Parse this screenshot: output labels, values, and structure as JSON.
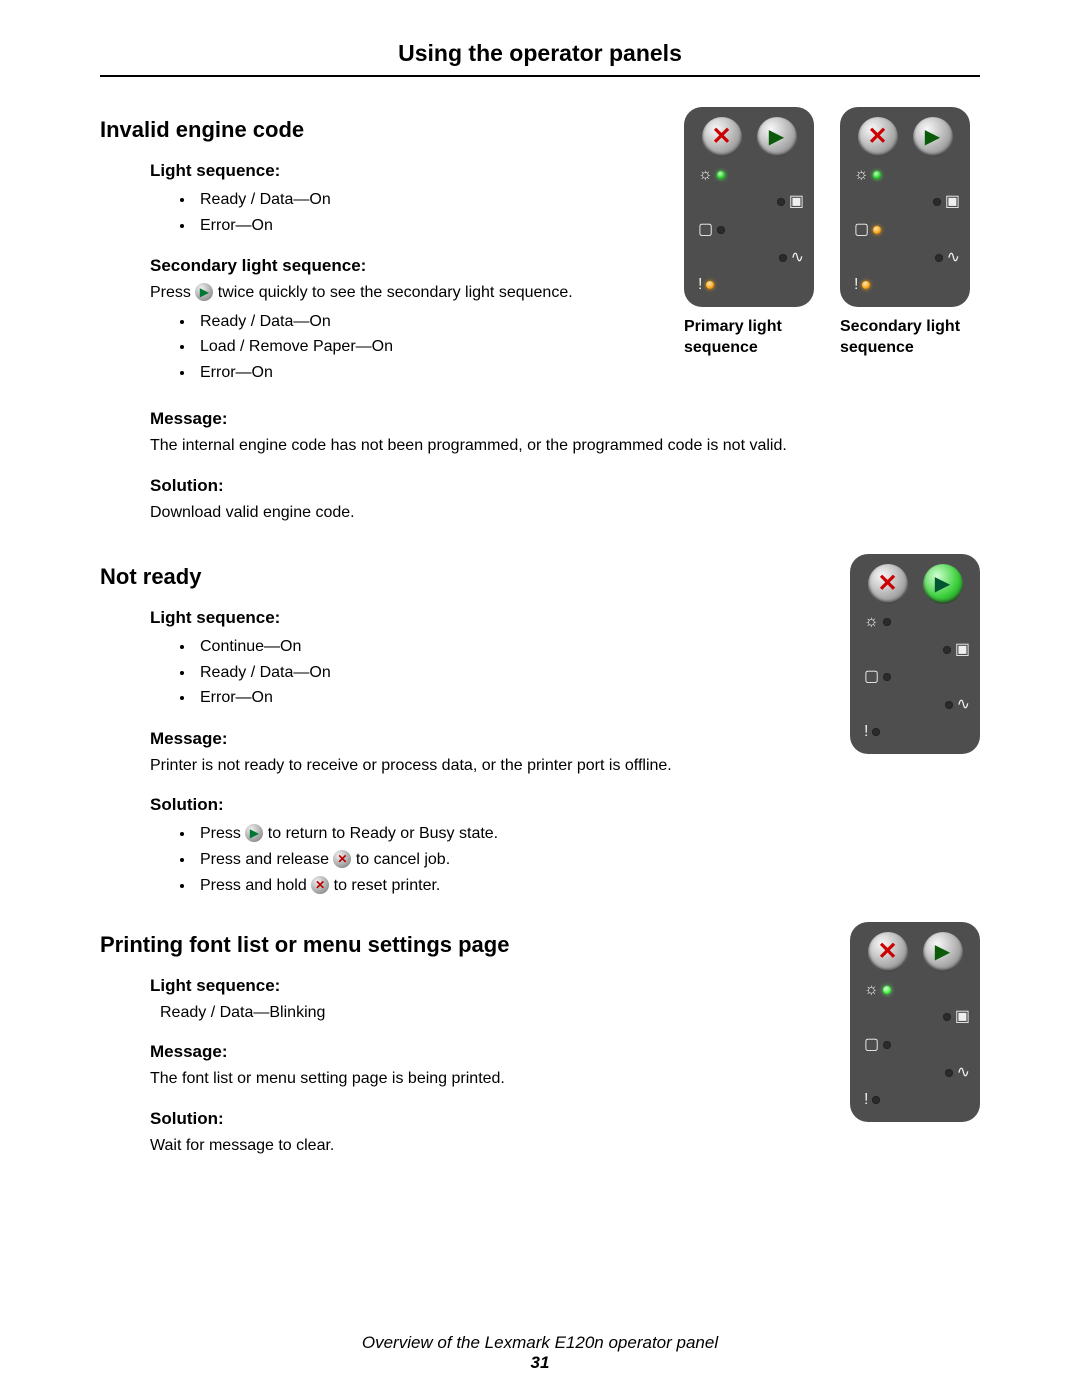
{
  "title": "Using the operator panels",
  "footer_text": "Overview of the Lexmark E120n operator panel",
  "page_number": "31",
  "glyph": {
    "play": "▶",
    "x": "✕",
    "bulb": "☼",
    "toner": "▣",
    "paper": "▢",
    "jam": "∿",
    "exclaim": "!"
  },
  "captions": {
    "primary": "Primary light sequence",
    "secondary": "Secondary light sequence"
  },
  "sections": [
    {
      "heading": "Invalid engine code",
      "light_sequence_label": "Light sequence:",
      "light_sequence_items": [
        "Ready / Data—On",
        "Error—On"
      ],
      "secondary_seq_label": "Secondary light sequence:",
      "secondary_seq_intro_pre": "Press ",
      "secondary_seq_intro_post": " twice quickly to see the secondary light sequence.",
      "secondary_seq_items": [
        "Ready / Data—On",
        "Load / Remove Paper—On",
        "Error—On"
      ],
      "message_label": "Message:",
      "message_text": "The internal engine code has not been programmed, or the programmed code is not valid.",
      "solution_label": "Solution:",
      "solution_text": "Download valid engine code."
    },
    {
      "heading": "Not ready",
      "light_sequence_label": "Light sequence:",
      "light_sequence_items": [
        "Continue—On",
        "Ready / Data—On",
        "Error—On"
      ],
      "message_label": "Message:",
      "message_text": "Printer is not ready to receive or process data, or the printer port is offline.",
      "solution_label": "Solution:",
      "solution_items_pre": [
        "Press ",
        "Press and release ",
        "Press and hold "
      ],
      "solution_items_post": [
        " to return to Ready or Busy state.",
        " to cancel job.",
        " to reset printer."
      ]
    },
    {
      "heading": "Printing font list or menu settings page",
      "light_sequence_label": "Light sequence:",
      "light_sequence_text": "Ready / Data—Blinking",
      "message_label": "Message:",
      "message_text": "The font list or menu setting page is being printed.",
      "solution_label": "Solution:",
      "solution_text": "Wait for message to clear."
    }
  ],
  "panels": {
    "s0_primary": {
      "continue_lit": false,
      "ready": "on",
      "paper": "off",
      "error": "on"
    },
    "s0_secondary": {
      "continue_lit": false,
      "ready": "on",
      "paper": "on",
      "error": "on"
    },
    "s1": {
      "continue_lit": true,
      "ready": "off",
      "paper": "off",
      "error": "off"
    },
    "s2": {
      "continue_lit": false,
      "ready": "blink",
      "paper": "off",
      "error": "off"
    }
  }
}
